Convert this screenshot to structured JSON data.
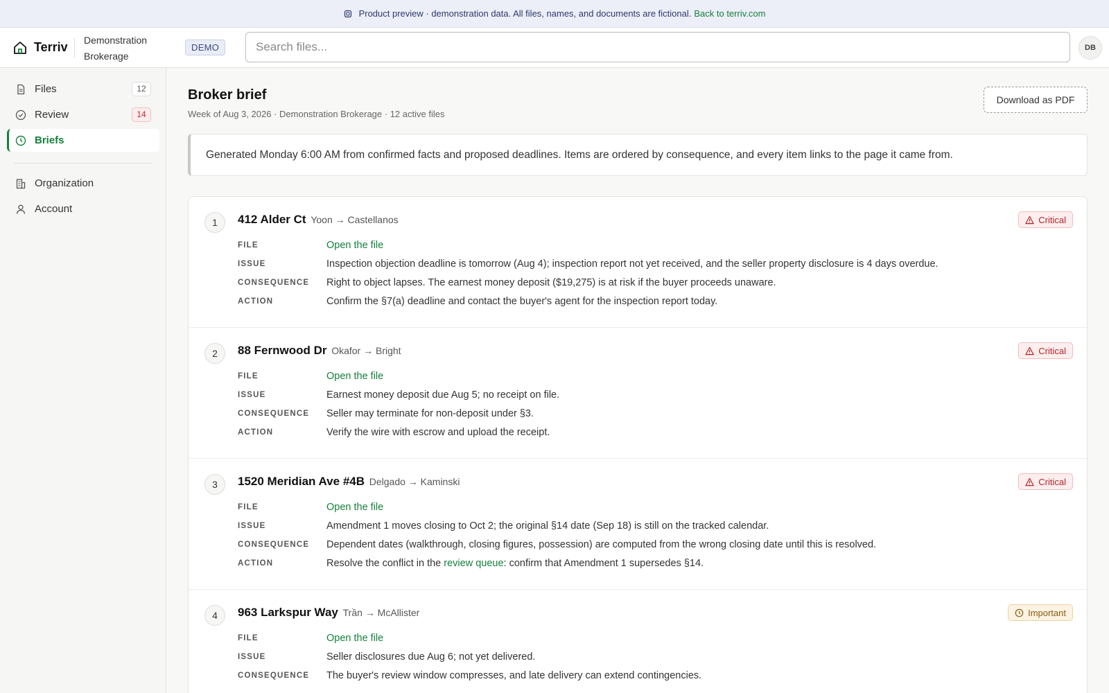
{
  "banner": {
    "text": "Product preview · demonstration data. All files, names, and documents are fictional.",
    "link": "Back to terriv.com"
  },
  "topbar": {
    "brand": "Terriv",
    "org_line1": "Demonstration",
    "org_line2": "Brokerage",
    "badge": "DEMO",
    "search_placeholder": "Search files...",
    "avatar": "DB"
  },
  "sidebar": {
    "items": [
      {
        "label": "Files",
        "count": "12",
        "icon": "file-icon"
      },
      {
        "label": "Review",
        "count": "14",
        "icon": "check-circle-icon"
      },
      {
        "label": "Briefs",
        "icon": "clock-icon",
        "active": true
      },
      {
        "label": "Organization",
        "icon": "building-icon"
      },
      {
        "label": "Account",
        "icon": "user-icon"
      }
    ]
  },
  "page": {
    "title": "Broker brief",
    "subtitle": "Week of Aug 3, 2026 · Demonstration Brokerage · 12 active files",
    "download_label": "Download as PDF",
    "note": "Generated Monday 6:00 AM from confirmed facts and proposed deadlines. Items are ordered by consequence, and every item links to the page it came from."
  },
  "labels": {
    "file": "FILE",
    "issue": "ISSUE",
    "consequence": "CONSEQUENCE",
    "action": "ACTION",
    "open_file": "Open the file"
  },
  "colors": {
    "accent": "#15803d",
    "critical": "#b4232a",
    "important": "#8a5a12"
  },
  "items": [
    {
      "num": "1",
      "address": "412 Alder Ct",
      "parties": "Yoon → Castellanos",
      "severity": "Critical",
      "issue": "Inspection objection deadline is tomorrow (Aug 4); inspection report not yet received, and the seller property disclosure is 4 days overdue.",
      "consequence": "Right to object lapses. The earnest money deposit ($19,275) is at risk if the buyer proceeds unaware.",
      "action": "Confirm the §7(a) deadline and contact the buyer's agent for the inspection report today."
    },
    {
      "num": "2",
      "address": "88 Fernwood Dr",
      "parties": "Okafor → Bright",
      "severity": "Critical",
      "issue": "Earnest money deposit due Aug 5; no receipt on file.",
      "consequence": "Seller may terminate for non-deposit under §3.",
      "action": "Verify the wire with escrow and upload the receipt."
    },
    {
      "num": "3",
      "address": "1520 Meridian Ave #4B",
      "parties": "Delgado → Kaminski",
      "severity": "Critical",
      "issue": "Amendment 1 moves closing to Oct 2; the original §14 date (Sep 18) is still on the tracked calendar.",
      "consequence": "Dependent dates (walkthrough, closing figures, possession) are computed from the wrong closing date until this is resolved.",
      "action_pre": "Resolve the conflict in the",
      "action_link": "review queue",
      "action_post": ": confirm that Amendment 1 supersedes §14."
    },
    {
      "num": "4",
      "address": "963 Larkspur Way",
      "parties": "Trần → McAllister",
      "severity": "Important",
      "issue": "Seller disclosures due Aug 6; not yet delivered.",
      "consequence": "The buyer's review window compresses, and late delivery can extend contingencies."
    }
  ]
}
